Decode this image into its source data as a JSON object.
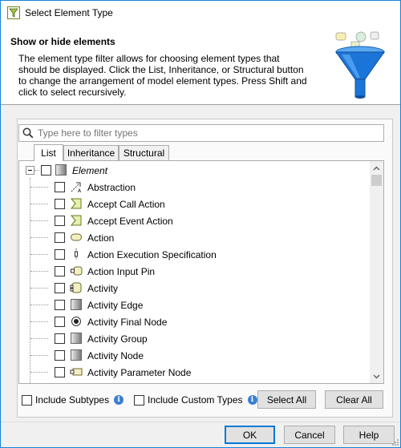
{
  "window": {
    "title": "Select Element Type",
    "app_icon": "filter-app-icon"
  },
  "header": {
    "title": "Show or hide elements",
    "description": "The element type filter allows for choosing element types that should be displayed. Click the List, Inheritance, or Structural button to change the arrangement of model element types. Press Shift and click to select recursively."
  },
  "search": {
    "placeholder": "Type here to filter types",
    "value": ""
  },
  "tabs": [
    {
      "label": "List",
      "active": true
    },
    {
      "label": "Inheritance",
      "active": false
    },
    {
      "label": "Structural",
      "active": false
    }
  ],
  "tree": {
    "root": {
      "label": "Element",
      "checked": false,
      "expanded": true,
      "icon": "element-icon"
    },
    "items": [
      {
        "label": "Abstraction",
        "checked": false,
        "icon": "abstraction-icon"
      },
      {
        "label": "Accept Call Action",
        "checked": false,
        "icon": "accept-call-action-icon"
      },
      {
        "label": "Accept Event Action",
        "checked": false,
        "icon": "accept-event-action-icon"
      },
      {
        "label": "Action",
        "checked": false,
        "icon": "action-icon"
      },
      {
        "label": "Action Execution Specification",
        "checked": false,
        "icon": "action-execution-specification-icon"
      },
      {
        "label": "Action Input Pin",
        "checked": false,
        "icon": "action-input-pin-icon"
      },
      {
        "label": "Activity",
        "checked": false,
        "icon": "activity-icon"
      },
      {
        "label": "Activity Edge",
        "checked": false,
        "icon": "activity-edge-icon"
      },
      {
        "label": "Activity Final Node",
        "checked": false,
        "icon": "activity-final-node-icon"
      },
      {
        "label": "Activity Group",
        "checked": false,
        "icon": "activity-group-icon"
      },
      {
        "label": "Activity Node",
        "checked": false,
        "icon": "activity-node-icon"
      },
      {
        "label": "Activity Parameter Node",
        "checked": false,
        "icon": "activity-parameter-node-icon"
      }
    ]
  },
  "options": {
    "include_subtypes": {
      "label": "Include Subtypes",
      "checked": false
    },
    "include_custom_types": {
      "label": "Include Custom Types",
      "checked": false
    }
  },
  "buttons": {
    "select_all": "Select All",
    "clear_all": "Clear All",
    "ok": "OK",
    "cancel": "Cancel",
    "help": "Help"
  },
  "colors": {
    "window_border": "#1883d7",
    "accent": "#0078d7",
    "info": "#3c7fd0"
  }
}
